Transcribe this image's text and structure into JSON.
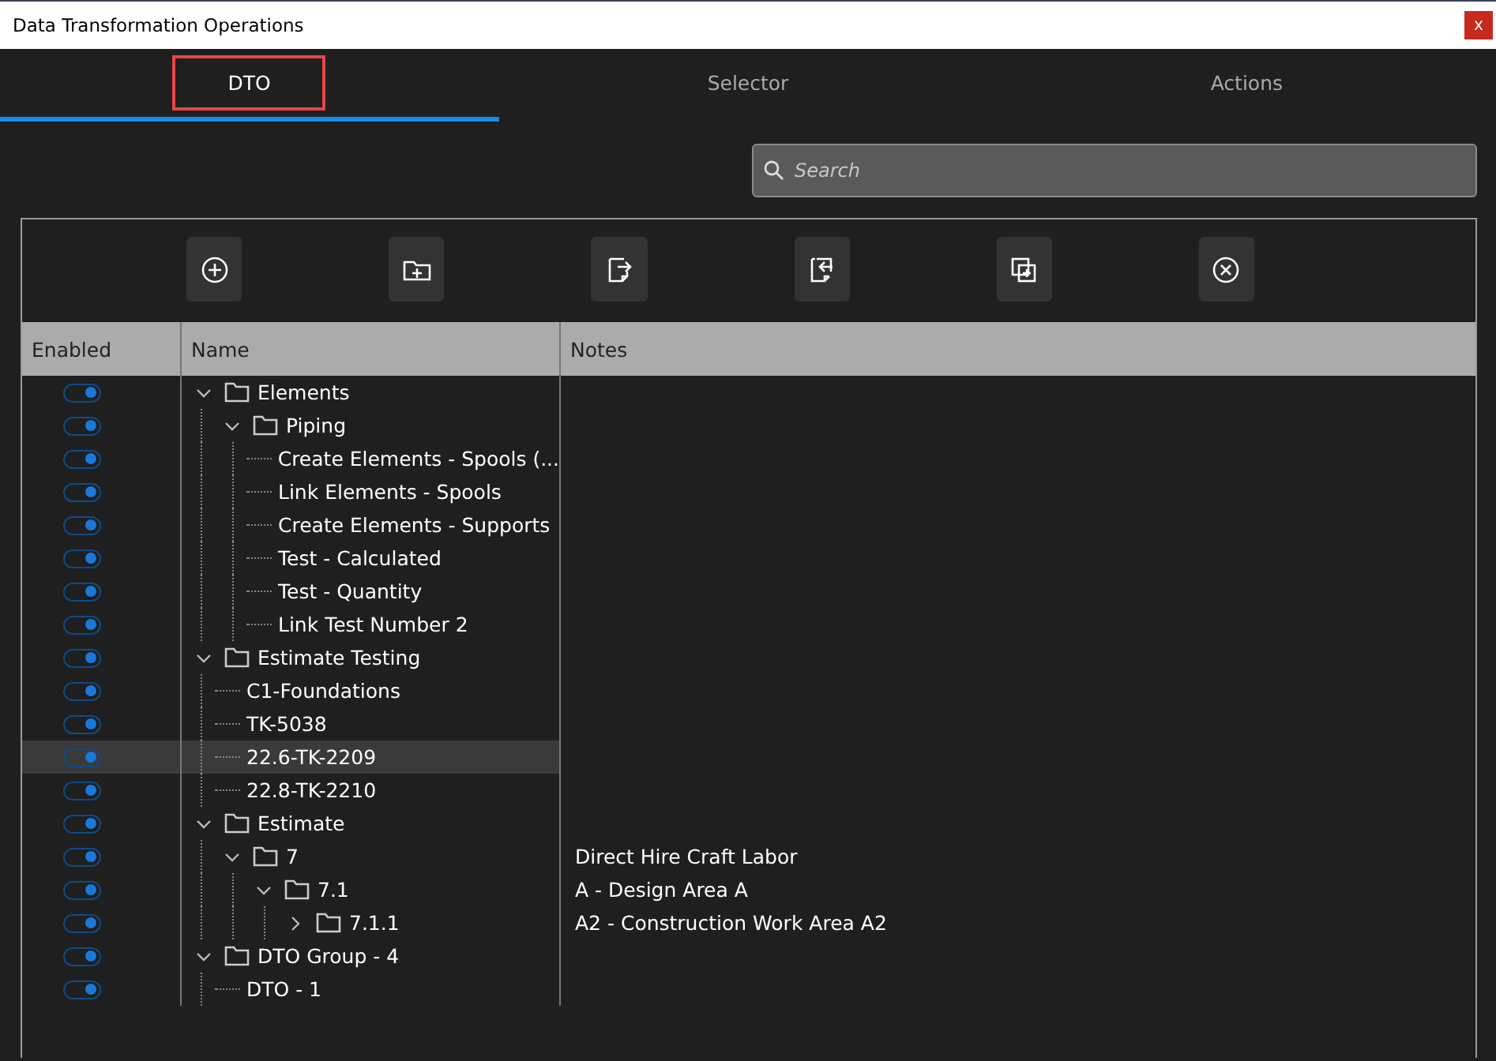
{
  "window": {
    "title": "Data Transformation Operations",
    "close": "x"
  },
  "tabs": [
    {
      "label": "DTO",
      "selected": true,
      "outlined": true
    },
    {
      "label": "Selector",
      "selected": false,
      "outlined": false
    },
    {
      "label": "Actions",
      "selected": false,
      "outlined": false
    }
  ],
  "search": {
    "placeholder": "Search"
  },
  "toolbar": [
    {
      "kind": "add"
    },
    {
      "kind": "add-folder"
    },
    {
      "kind": "export"
    },
    {
      "kind": "import"
    },
    {
      "kind": "duplicate"
    },
    {
      "kind": "delete"
    }
  ],
  "table": {
    "columns": [
      "Enabled",
      "Name",
      "Notes"
    ],
    "rows": [
      {
        "name": "Elements",
        "kind": "folder",
        "expanded": true,
        "enabled": true,
        "selected": false,
        "children": [
          {
            "name": "Piping",
            "kind": "folder",
            "expanded": true,
            "enabled": true,
            "selected": false,
            "children": [
              {
                "name": "Create Elements - Spools (...",
                "kind": "item",
                "enabled": true,
                "selected": false
              },
              {
                "name": "Link Elements - Spools",
                "kind": "item",
                "enabled": true,
                "selected": false
              },
              {
                "name": "Create Elements - Supports",
                "kind": "item",
                "enabled": true,
                "selected": false
              },
              {
                "name": "Test - Calculated",
                "kind": "item",
                "enabled": true,
                "selected": false
              },
              {
                "name": "Test - Quantity",
                "kind": "item",
                "enabled": true,
                "selected": false
              },
              {
                "name": "Link Test Number 2",
                "kind": "item",
                "enabled": true,
                "selected": false
              }
            ]
          }
        ]
      },
      {
        "name": "Estimate Testing",
        "kind": "folder",
        "expanded": true,
        "enabled": true,
        "selected": false,
        "children": [
          {
            "name": "C1-Foundations",
            "kind": "item",
            "enabled": true,
            "selected": false
          },
          {
            "name": "TK-5038",
            "kind": "item",
            "enabled": true,
            "selected": false
          },
          {
            "name": "22.6-TK-2209",
            "kind": "item",
            "enabled": true,
            "selected": true
          },
          {
            "name": "22.8-TK-2210",
            "kind": "item",
            "enabled": true,
            "selected": false
          }
        ]
      },
      {
        "name": "Estimate",
        "kind": "folder",
        "expanded": true,
        "enabled": true,
        "selected": false,
        "children": [
          {
            "name": "7",
            "kind": "folder",
            "expanded": true,
            "enabled": true,
            "selected": false,
            "notes": "Direct Hire Craft Labor",
            "children": [
              {
                "name": "7.1",
                "kind": "folder",
                "expanded": true,
                "enabled": true,
                "selected": false,
                "notes": "A - Design Area A",
                "children": [
                  {
                    "name": "7.1.1",
                    "kind": "folder",
                    "expanded": false,
                    "enabled": true,
                    "selected": false,
                    "notes": "A2 - Construction Work Area A2"
                  }
                ]
              }
            ]
          }
        ]
      },
      {
        "name": "DTO Group - 4",
        "kind": "folder",
        "expanded": true,
        "enabled": true,
        "selected": false,
        "children": [
          {
            "name": "DTO - 1",
            "kind": "item",
            "enabled": true,
            "selected": false
          }
        ]
      }
    ]
  }
}
